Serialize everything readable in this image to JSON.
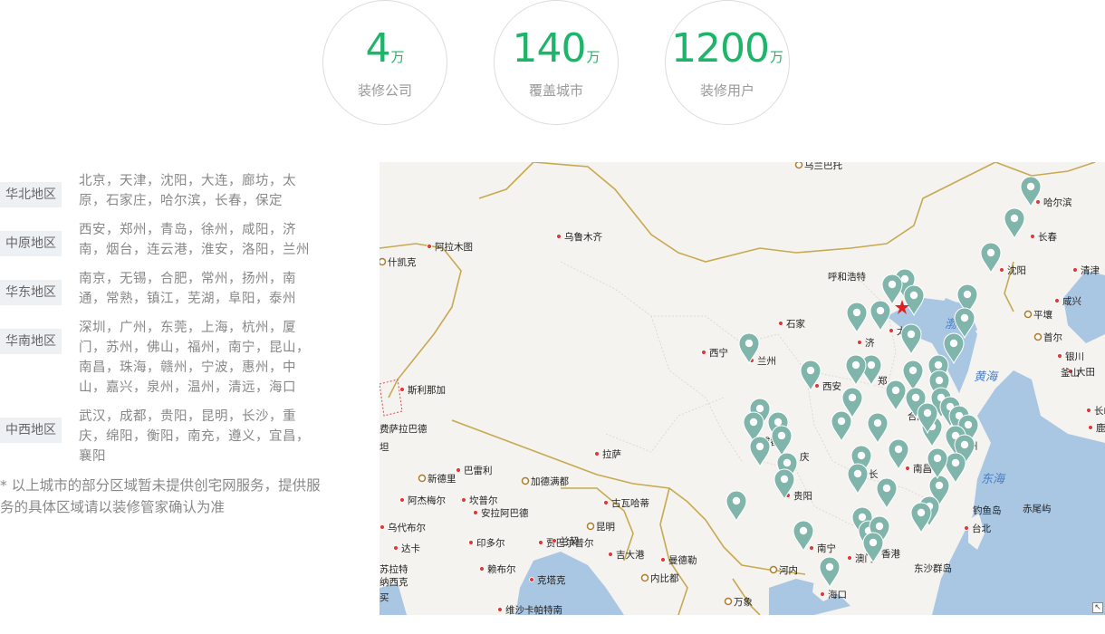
{
  "stats": [
    {
      "number": "4",
      "unit": "万",
      "label": "装修公司"
    },
    {
      "number": "140",
      "unit": "万",
      "label": "覆盖城市"
    },
    {
      "number": "1200",
      "unit": "万",
      "label": "装修用户"
    }
  ],
  "regions": [
    {
      "name": "华北地区",
      "cities": "北京，天津，沈阳，大连，廊坊，太原，石家庄，哈尔滨，长春，保定"
    },
    {
      "name": "中原地区",
      "cities": "西安，郑州，青岛，徐州，咸阳，济南，烟台，连云港，淮安，洛阳，兰州"
    },
    {
      "name": "华东地区",
      "cities": "南京，无锡，合肥，常州，扬州，南通，常熟，镇江，芜湖，阜阳，泰州"
    },
    {
      "name": "华南地区",
      "cities": "深圳，广州，东莞，上海，杭州，厦门，苏州，佛山，福州，南宁，昆山，南昌，珠海，赣州，宁波，惠州，中山，嘉兴，泉州，温州，清远，海口"
    },
    {
      "name": "中西地区",
      "cities": "武汉，成都，贵阳，昆明，长沙，重庆，绵阳，衡阳，南充，遵义，宜昌，襄阳"
    }
  ],
  "note": "* 以上城市的部分区域暂未提供创宅网服务，提供服务的具体区域请以装修管家确认为准",
  "map": {
    "pin_color": "#7fb5aa",
    "land_color": "#f4f3ef",
    "sea_color": "#a9c6e3",
    "border_color": "#c8a951",
    "city_labels": [
      {
        "text": "乌兰巴托"
      },
      {
        "text": "哈尔滨"
      },
      {
        "text": "乌鲁木齐"
      },
      {
        "text": "阿拉木图"
      },
      {
        "text": "什凯克"
      },
      {
        "text": "长春"
      },
      {
        "text": "沈阳"
      },
      {
        "text": "清津"
      },
      {
        "text": "呼和浩特"
      },
      {
        "text": "咸兴"
      },
      {
        "text": "平壤"
      },
      {
        "text": "首尔"
      },
      {
        "text": "银川"
      },
      {
        "text": "石家"
      },
      {
        "text": "太原"
      },
      {
        "text": "济"
      },
      {
        "text": "大田"
      },
      {
        "text": "西宁"
      },
      {
        "text": "兰州"
      },
      {
        "text": "釜山"
      },
      {
        "text": "西安"
      },
      {
        "text": "郑"
      },
      {
        "text": "斯利那加"
      },
      {
        "text": "长崎"
      },
      {
        "text": "合肥"
      },
      {
        "text": "上海"
      },
      {
        "text": "鹿儿"
      },
      {
        "text": "费萨拉巴德"
      },
      {
        "text": "成都"
      },
      {
        "text": "坦"
      },
      {
        "text": "拉萨"
      },
      {
        "text": "庆"
      },
      {
        "text": "州"
      },
      {
        "text": "新德里"
      },
      {
        "text": "巴雷利"
      },
      {
        "text": "南昌"
      },
      {
        "text": "长"
      },
      {
        "text": "加德满都"
      },
      {
        "text": "贵阳"
      },
      {
        "text": "阿杰梅尔"
      },
      {
        "text": "坎普尔"
      },
      {
        "text": "古瓦哈蒂"
      },
      {
        "text": "安拉阿巴德"
      },
      {
        "text": "钓鱼岛"
      },
      {
        "text": "赤尾屿"
      },
      {
        "text": "乌代布尔"
      },
      {
        "text": "达卡"
      },
      {
        "text": "昆明"
      },
      {
        "text": "台北"
      },
      {
        "text": "印多尔"
      },
      {
        "text": "贾巴尔普尔"
      },
      {
        "text": "兰契"
      },
      {
        "text": "吉大港"
      },
      {
        "text": "曼德勒"
      },
      {
        "text": "南宁"
      },
      {
        "text": "澳门"
      },
      {
        "text": "香港"
      },
      {
        "text": "苏拉特"
      },
      {
        "text": "赖布尔"
      },
      {
        "text": "河内"
      },
      {
        "text": "东沙群岛"
      },
      {
        "text": "纳西克"
      },
      {
        "text": "克塔克"
      },
      {
        "text": "内比都"
      },
      {
        "text": "海口"
      },
      {
        "text": "万象"
      },
      {
        "text": "买"
      },
      {
        "text": "维沙卡帕特南"
      },
      {
        "text": "渤海"
      },
      {
        "text": "黄海"
      },
      {
        "text": "东海"
      }
    ]
  }
}
